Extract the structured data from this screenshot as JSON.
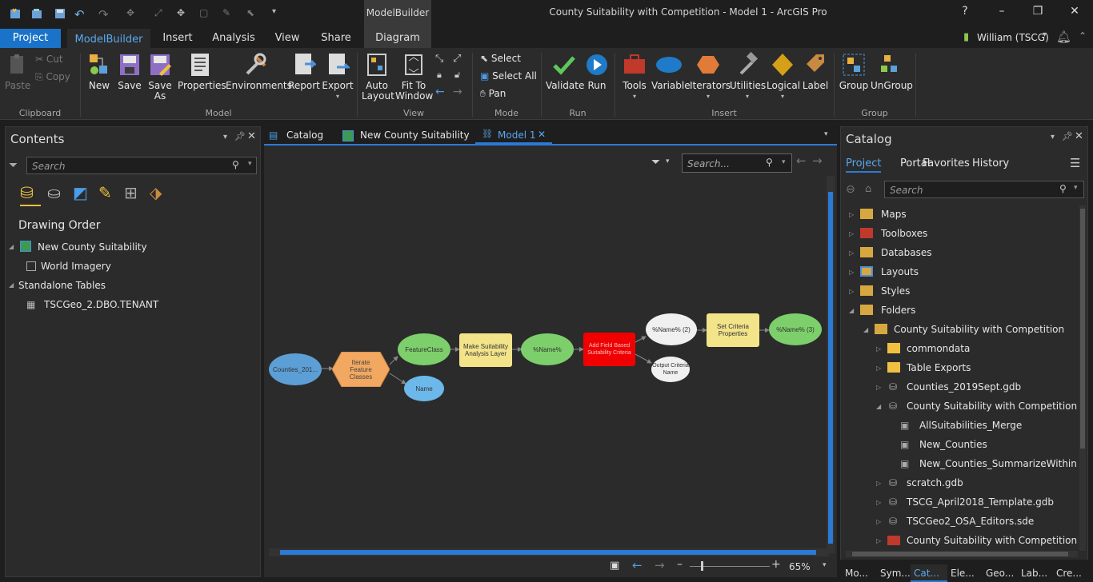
{
  "app": {
    "title": "County Suitability with Competition - Model 1 - ArcGIS Pro",
    "context_tab": "ModelBuilder",
    "user": "William (TSCG)",
    "help": "?"
  },
  "tabs": [
    "Project",
    "ModelBuilder",
    "Insert",
    "Analysis",
    "View",
    "Share",
    "Diagram"
  ],
  "ribbon": {
    "clipboard": {
      "paste": "Paste",
      "cut": "Cut",
      "copy": "Copy",
      "group": "Clipboard"
    },
    "model": {
      "new": "New",
      "save": "Save",
      "save_as_1": "Save",
      "save_as_2": "As",
      "properties": "Properties",
      "environments": "Environments",
      "report": "Report",
      "export": "Export",
      "group": "Model"
    },
    "view": {
      "auto_1": "Auto",
      "auto_2": "Layout",
      "fit_1": "Fit To",
      "fit_2": "Window",
      "group": "View"
    },
    "mode": {
      "select": "Select",
      "select_all": "Select All",
      "pan": "Pan",
      "group": "Mode"
    },
    "run": {
      "validate": "Validate",
      "run": "Run",
      "group": "Run"
    },
    "insert": {
      "tools": "Tools",
      "variable": "Variable",
      "iterators": "Iterators",
      "utilities": "Utilities",
      "logical": "Logical",
      "label": "Label",
      "group": "Insert"
    },
    "group_g": {
      "group": "Group",
      "ungroup": "UnGroup",
      "grp": "Group"
    }
  },
  "contents": {
    "title": "Contents",
    "search_placeholder": "Search",
    "drawing_order": "Drawing Order",
    "map": "New County Suitability",
    "layer": "World Imagery",
    "standalone": "Standalone Tables",
    "table": "TSCGeo_2.DBO.TENANT"
  },
  "doc_tabs": [
    "Catalog",
    "New County Suitability",
    "Model 1"
  ],
  "canvas": {
    "search_placeholder": "Search...",
    "zoom": "65%"
  },
  "model_nodes": {
    "counties": "Counties_201...",
    "iterate": "Iterate Feature Classes",
    "featureclass": "FeatureClass",
    "name": "Name",
    "make": "Make Suitability Analysis Layer",
    "name_var": "%Name%",
    "addfield": "Add Field Based Suitability Criteria",
    "name2": "%Name% (2)",
    "output": "Output Criteria Name",
    "setcrit": "Set Criteria Properties",
    "name3": "%Name% (3)"
  },
  "catalog": {
    "title": "Catalog",
    "tabs": [
      "Project",
      "Portal",
      "Favorites",
      "History"
    ],
    "search_placeholder": "Search",
    "items": [
      "Maps",
      "Toolboxes",
      "Databases",
      "Layouts",
      "Styles",
      "Folders",
      "County Suitability with Competition",
      "commondata",
      "Table Exports",
      "Counties_2019Sept.gdb",
      "County Suitability with Competition.gdb",
      "AllSuitabilities_Merge",
      "New_Counties",
      "New_Counties_SummarizeWithin",
      "scratch.gdb",
      "TSCG_April2018_Template.gdb",
      "TSCGeo2_OSA_Editors.sde",
      "County Suitability with Competition.tbx"
    ]
  },
  "bottom_tabs": [
    "Mo...",
    "Sym...",
    "Cat...",
    "Ele...",
    "Geo...",
    "Lab...",
    "Cre..."
  ]
}
